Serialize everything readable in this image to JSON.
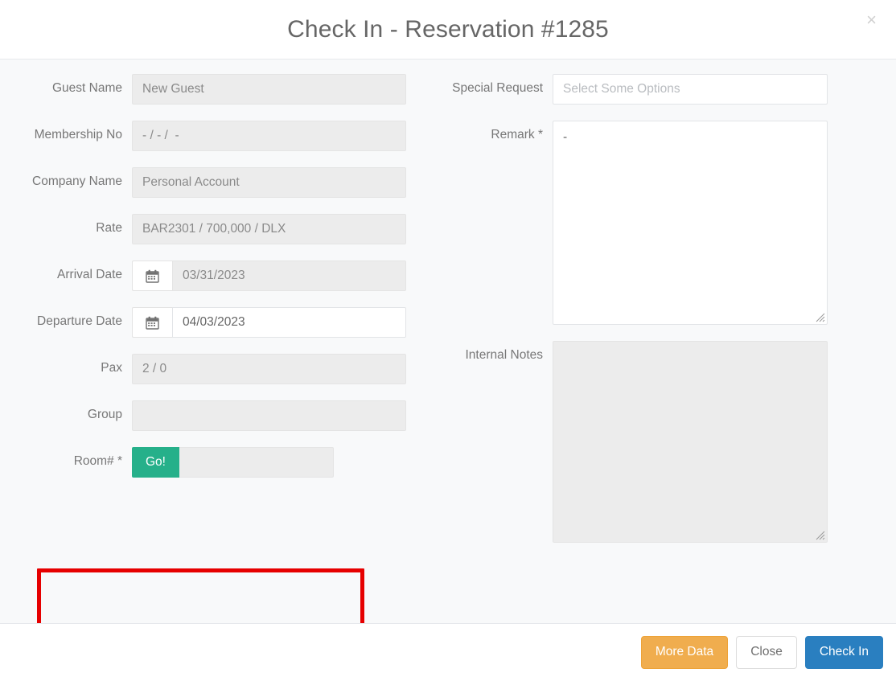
{
  "modal": {
    "title": "Check In - Reservation #1285",
    "close_icon_label": "×"
  },
  "form": {
    "left_fields": [
      {
        "label": "Guest Name",
        "name": "guest-name",
        "value": "New Guest",
        "type": "text",
        "disabled": true
      },
      {
        "label": "Membership No",
        "name": "membership-no",
        "value": "- / - /  -",
        "type": "text",
        "disabled": true
      },
      {
        "label": "Company Name",
        "name": "company-name",
        "value": "Personal Account",
        "type": "text",
        "disabled": true
      },
      {
        "label": "Rate",
        "name": "rate",
        "value": "BAR2301 / 700,000 / DLX",
        "type": "text",
        "disabled": true
      },
      {
        "label": "Arrival Date",
        "name": "arrival-date",
        "value": "03/31/2023",
        "type": "date",
        "disabled": true
      },
      {
        "label": "Departure Date",
        "name": "departure-date",
        "value": "04/03/2023",
        "type": "date",
        "disabled": false
      },
      {
        "label": "Pax",
        "name": "pax",
        "value": "2 / 0",
        "type": "text",
        "disabled": true
      },
      {
        "label": "Group",
        "name": "group",
        "value": "",
        "type": "text",
        "disabled": true
      }
    ],
    "room_row": {
      "label": "Room# *",
      "go_button_label": "Go!",
      "room_value": "",
      "room_placeholder": ""
    },
    "right_fields": {
      "special_request": {
        "label": "Special Request",
        "placeholder": "Select Some Options",
        "value": ""
      },
      "remark": {
        "label": "Remark *",
        "value": "-"
      },
      "internal_notes": {
        "label": "Internal Notes",
        "value": ""
      }
    }
  },
  "footer": {
    "more_data_label": "More Data",
    "close_label": "Close",
    "check_in_label": "Check In"
  },
  "colors": {
    "go_button": "#26b08a",
    "more_data": "#f0ad4e",
    "check_in": "#2a7fc0",
    "highlight": "#e60000",
    "body_bg": "#f8f9fa",
    "field_disabled_bg": "#ececec"
  }
}
